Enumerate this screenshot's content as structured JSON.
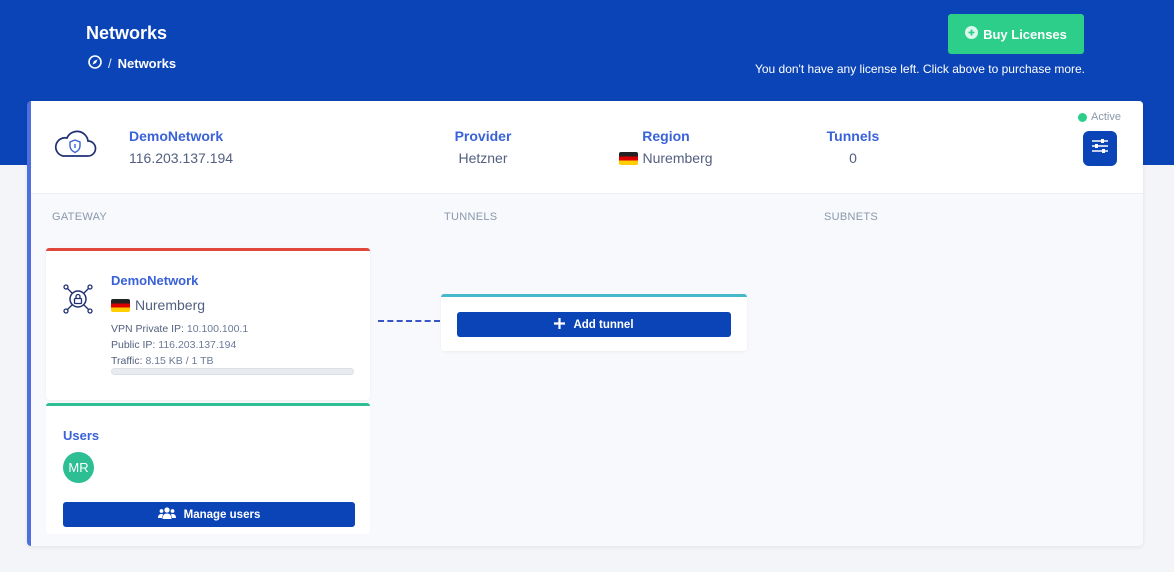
{
  "header": {
    "title": "Networks",
    "breadcrumb": {
      "icon": "compass-icon",
      "separator": "/",
      "current": "Networks"
    },
    "buy_button": {
      "label": "Buy Licenses",
      "icon": "plus-circle-icon"
    },
    "license_note": "You don't have any license left. Click above to purchase more."
  },
  "network": {
    "icon": "cloud-shield-icon",
    "name": "DemoNetwork",
    "ip": "116.203.137.194",
    "provider": {
      "label": "Provider",
      "value": "Hetzner"
    },
    "region": {
      "label": "Region",
      "value": "Nuremberg",
      "flag": "germany-flag-icon"
    },
    "tunnels": {
      "label": "Tunnels",
      "value": "0"
    },
    "status": {
      "label": "Active",
      "color": "#2dce89"
    },
    "settings_icon": "sliders-icon"
  },
  "sections": {
    "gateway": "GATEWAY",
    "tunnels": "TUNNELS",
    "subnets": "SUBNETS"
  },
  "gateway": {
    "icon": "network-lock-icon",
    "name": "DemoNetwork",
    "region": "Nuremberg",
    "vpn_ip_label": "VPN Private IP:",
    "vpn_ip": "10.100.100.1",
    "public_ip_label": "Public IP:",
    "public_ip": "116.203.137.194",
    "traffic_label": "Traffic:",
    "traffic": "8.15 KB / 1 TB"
  },
  "users": {
    "title": "Users",
    "avatar_initials": "MR",
    "manage_button": {
      "label": "Manage users",
      "icon": "users-icon"
    }
  },
  "tunnel": {
    "add_button": {
      "label": "Add tunnel",
      "icon": "plus-icon"
    }
  },
  "colors": {
    "brand": "#0b44b6",
    "accent_green": "#2dce89",
    "gateway_border": "#e0483c",
    "users_border": "#2dbe93",
    "tunnel_border": "#45b8c9",
    "link_blue": "#3a62d8"
  }
}
